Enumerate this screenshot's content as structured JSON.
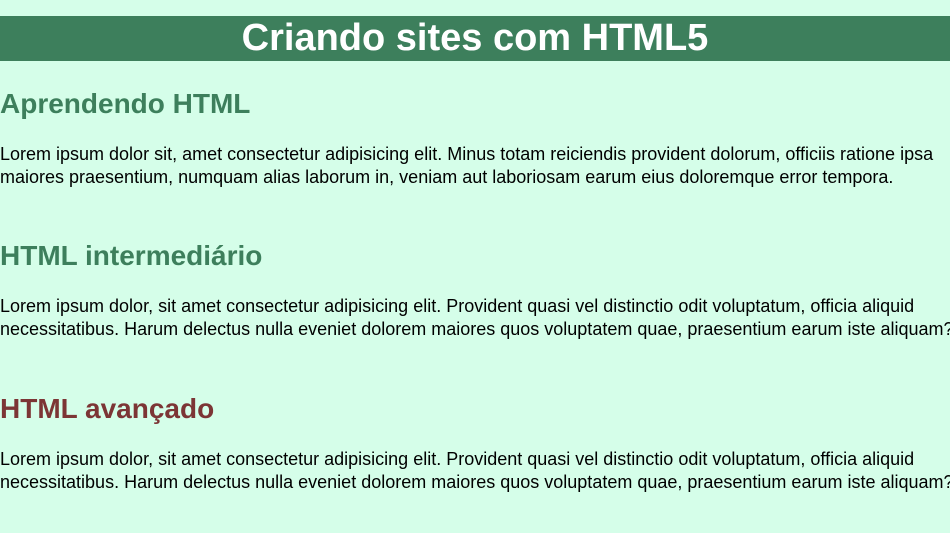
{
  "header": {
    "title": "Criando sites com HTML5"
  },
  "sections": [
    {
      "title": "Aprendendo HTML",
      "title_color": "#3d7f5c",
      "text": "Lorem ipsum dolor sit, amet consectetur adipisicing elit. Minus totam reiciendis provident dolorum, officiis ratione ipsa maiores praesentium, numquam alias laborum in, veniam aut laboriosam earum eius doloremque error tempora."
    },
    {
      "title": "HTML intermediário",
      "title_color": "#3d7f5c",
      "text": "Lorem ipsum dolor, sit amet consectetur adipisicing elit. Provident quasi vel distinctio odit voluptatum, officia aliquid necessitatibus. Harum delectus nulla eveniet dolorem maiores quos voluptatem quae, praesentium earum iste aliquam?"
    },
    {
      "title": "HTML avançado",
      "title_color": "#7c3535",
      "text": "Lorem ipsum dolor, sit amet consectetur adipisicing elit. Provident quasi vel distinctio odit voluptatum, officia aliquid necessitatibus. Harum delectus nulla eveniet dolorem maiores quos voluptatem quae, praesentium earum iste aliquam?"
    }
  ],
  "colors": {
    "background": "#d5fee9",
    "header_background": "#3d7f5c",
    "header_text": "#ffffff"
  }
}
